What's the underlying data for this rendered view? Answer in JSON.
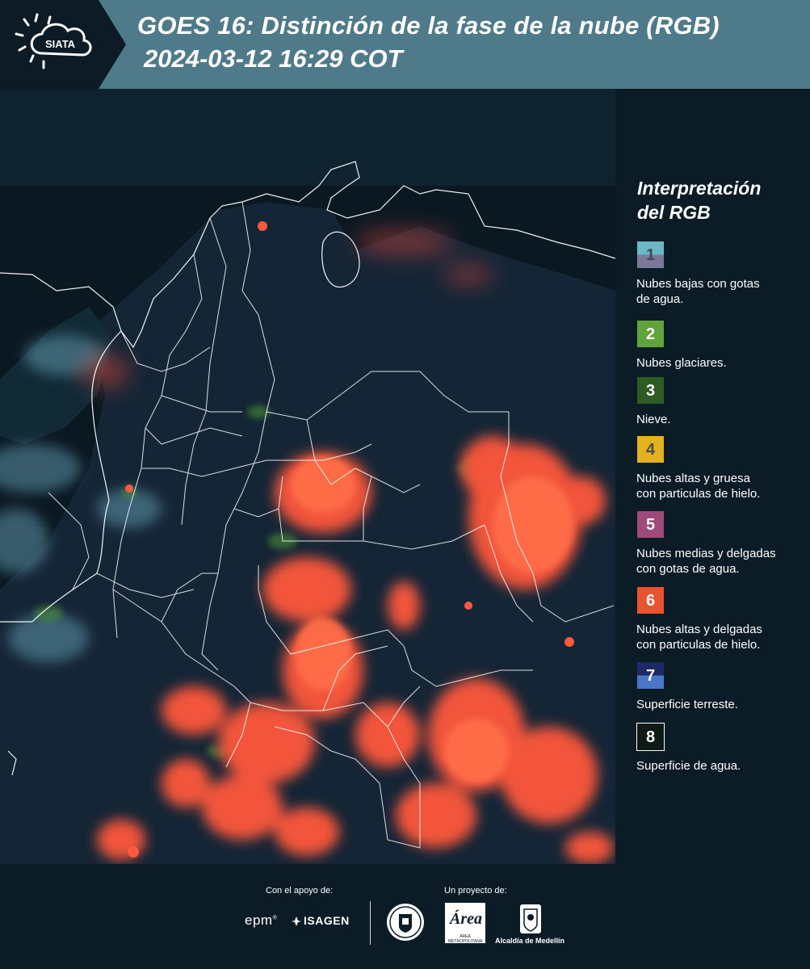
{
  "header": {
    "logo_text": "SIATA",
    "title_line1": "GOES 16: Distinción de la fase de la nube (RGB)",
    "title_line2": "2024-03-12 16:29 COT"
  },
  "legend": {
    "title_line1": "Interpretación",
    "title_line2": "del RGB",
    "items": [
      {
        "number": "1",
        "label_line1": "Nubes bajas con gotas",
        "label_line2": "de agua.",
        "color_top": "#6bb8c6",
        "color_bottom": "#7a7a98",
        "text_color": "#3d4a58"
      },
      {
        "number": "2",
        "label_line1": "Nubes glaciares.",
        "label_line2": "",
        "color_top": "#5fa33a",
        "color_bottom": "#5fa33a",
        "text_color": "#ffffff"
      },
      {
        "number": "3",
        "label_line1": "Nieve.",
        "label_line2": "",
        "color_top": "#2e5c22",
        "color_bottom": "#2e5c22",
        "text_color": "#ffffff"
      },
      {
        "number": "4",
        "label_line1": "Nubes altas y gruesa",
        "label_line2": "con particulas de hielo.",
        "color_top": "#e2b21f",
        "color_bottom": "#e2b21f",
        "text_color": "#4a4a4a"
      },
      {
        "number": "5",
        "label_line1": "Nubes medias y delgadas",
        "label_line2": "con gotas de agua.",
        "color_top": "#a04a7c",
        "color_bottom": "#a04a7c",
        "text_color": "#ffffff"
      },
      {
        "number": "6",
        "label_line1": "Nubes altas y delgadas",
        "label_line2": "con particulas de hielo.",
        "color_top": "#e9532f",
        "color_bottom": "#e9532f",
        "text_color": "#ffffff"
      },
      {
        "number": "7",
        "label_line1": "Superficie terreste.",
        "label_line2": "",
        "color_top": "#1c2a66",
        "color_bottom": "#4a76c8",
        "text_color": "#ffffff"
      },
      {
        "number": "8",
        "label_line1": "Superficie de agua.",
        "label_line2": "",
        "color_top": "#0d1a16",
        "color_bottom": "#0d1a16",
        "text_color": "#ffffff"
      }
    ]
  },
  "footer": {
    "support_label": "Con el apoyo de:",
    "project_label": "Un proyecto de:",
    "sponsor1": "epm",
    "sponsor2": "ISAGEN",
    "partner1": "ÁREA METROPOLITANA Valle de Aburrá",
    "partner2": "Alcaldía de Medellín"
  }
}
